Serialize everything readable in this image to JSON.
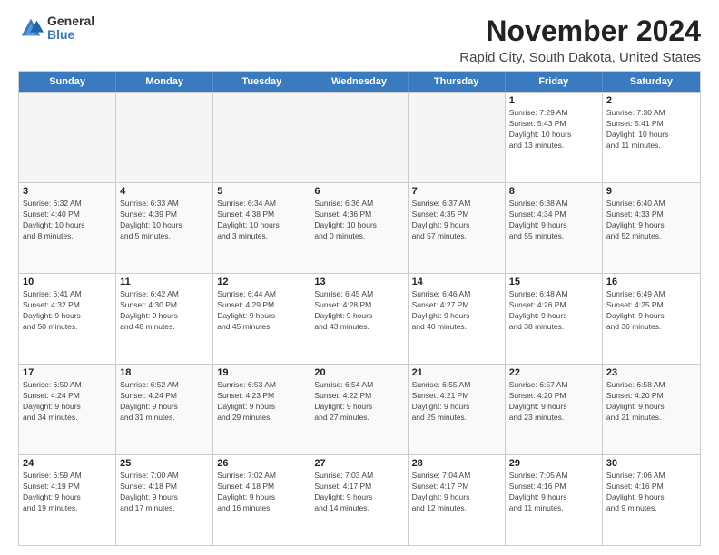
{
  "logo": {
    "general": "General",
    "blue": "Blue"
  },
  "title": "November 2024",
  "subtitle": "Rapid City, South Dakota, United States",
  "header_days": [
    "Sunday",
    "Monday",
    "Tuesday",
    "Wednesday",
    "Thursday",
    "Friday",
    "Saturday"
  ],
  "rows": [
    [
      {
        "day": "",
        "text": "",
        "empty": true
      },
      {
        "day": "",
        "text": "",
        "empty": true
      },
      {
        "day": "",
        "text": "",
        "empty": true
      },
      {
        "day": "",
        "text": "",
        "empty": true
      },
      {
        "day": "",
        "text": "",
        "empty": true
      },
      {
        "day": "1",
        "text": "Sunrise: 7:29 AM\nSunset: 5:43 PM\nDaylight: 10 hours\nand 13 minutes."
      },
      {
        "day": "2",
        "text": "Sunrise: 7:30 AM\nSunset: 5:41 PM\nDaylight: 10 hours\nand 11 minutes."
      }
    ],
    [
      {
        "day": "3",
        "text": "Sunrise: 6:32 AM\nSunset: 4:40 PM\nDaylight: 10 hours\nand 8 minutes."
      },
      {
        "day": "4",
        "text": "Sunrise: 6:33 AM\nSunset: 4:39 PM\nDaylight: 10 hours\nand 5 minutes."
      },
      {
        "day": "5",
        "text": "Sunrise: 6:34 AM\nSunset: 4:38 PM\nDaylight: 10 hours\nand 3 minutes."
      },
      {
        "day": "6",
        "text": "Sunrise: 6:36 AM\nSunset: 4:36 PM\nDaylight: 10 hours\nand 0 minutes."
      },
      {
        "day": "7",
        "text": "Sunrise: 6:37 AM\nSunset: 4:35 PM\nDaylight: 9 hours\nand 57 minutes."
      },
      {
        "day": "8",
        "text": "Sunrise: 6:38 AM\nSunset: 4:34 PM\nDaylight: 9 hours\nand 55 minutes."
      },
      {
        "day": "9",
        "text": "Sunrise: 6:40 AM\nSunset: 4:33 PM\nDaylight: 9 hours\nand 52 minutes."
      }
    ],
    [
      {
        "day": "10",
        "text": "Sunrise: 6:41 AM\nSunset: 4:32 PM\nDaylight: 9 hours\nand 50 minutes."
      },
      {
        "day": "11",
        "text": "Sunrise: 6:42 AM\nSunset: 4:30 PM\nDaylight: 9 hours\nand 48 minutes."
      },
      {
        "day": "12",
        "text": "Sunrise: 6:44 AM\nSunset: 4:29 PM\nDaylight: 9 hours\nand 45 minutes."
      },
      {
        "day": "13",
        "text": "Sunrise: 6:45 AM\nSunset: 4:28 PM\nDaylight: 9 hours\nand 43 minutes."
      },
      {
        "day": "14",
        "text": "Sunrise: 6:46 AM\nSunset: 4:27 PM\nDaylight: 9 hours\nand 40 minutes."
      },
      {
        "day": "15",
        "text": "Sunrise: 6:48 AM\nSunset: 4:26 PM\nDaylight: 9 hours\nand 38 minutes."
      },
      {
        "day": "16",
        "text": "Sunrise: 6:49 AM\nSunset: 4:25 PM\nDaylight: 9 hours\nand 36 minutes."
      }
    ],
    [
      {
        "day": "17",
        "text": "Sunrise: 6:50 AM\nSunset: 4:24 PM\nDaylight: 9 hours\nand 34 minutes."
      },
      {
        "day": "18",
        "text": "Sunrise: 6:52 AM\nSunset: 4:24 PM\nDaylight: 9 hours\nand 31 minutes."
      },
      {
        "day": "19",
        "text": "Sunrise: 6:53 AM\nSunset: 4:23 PM\nDaylight: 9 hours\nand 29 minutes."
      },
      {
        "day": "20",
        "text": "Sunrise: 6:54 AM\nSunset: 4:22 PM\nDaylight: 9 hours\nand 27 minutes."
      },
      {
        "day": "21",
        "text": "Sunrise: 6:55 AM\nSunset: 4:21 PM\nDaylight: 9 hours\nand 25 minutes."
      },
      {
        "day": "22",
        "text": "Sunrise: 6:57 AM\nSunset: 4:20 PM\nDaylight: 9 hours\nand 23 minutes."
      },
      {
        "day": "23",
        "text": "Sunrise: 6:58 AM\nSunset: 4:20 PM\nDaylight: 9 hours\nand 21 minutes."
      }
    ],
    [
      {
        "day": "24",
        "text": "Sunrise: 6:59 AM\nSunset: 4:19 PM\nDaylight: 9 hours\nand 19 minutes."
      },
      {
        "day": "25",
        "text": "Sunrise: 7:00 AM\nSunset: 4:18 PM\nDaylight: 9 hours\nand 17 minutes."
      },
      {
        "day": "26",
        "text": "Sunrise: 7:02 AM\nSunset: 4:18 PM\nDaylight: 9 hours\nand 16 minutes."
      },
      {
        "day": "27",
        "text": "Sunrise: 7:03 AM\nSunset: 4:17 PM\nDaylight: 9 hours\nand 14 minutes."
      },
      {
        "day": "28",
        "text": "Sunrise: 7:04 AM\nSunset: 4:17 PM\nDaylight: 9 hours\nand 12 minutes."
      },
      {
        "day": "29",
        "text": "Sunrise: 7:05 AM\nSunset: 4:16 PM\nDaylight: 9 hours\nand 11 minutes."
      },
      {
        "day": "30",
        "text": "Sunrise: 7:06 AM\nSunset: 4:16 PM\nDaylight: 9 hours\nand 9 minutes."
      }
    ]
  ]
}
